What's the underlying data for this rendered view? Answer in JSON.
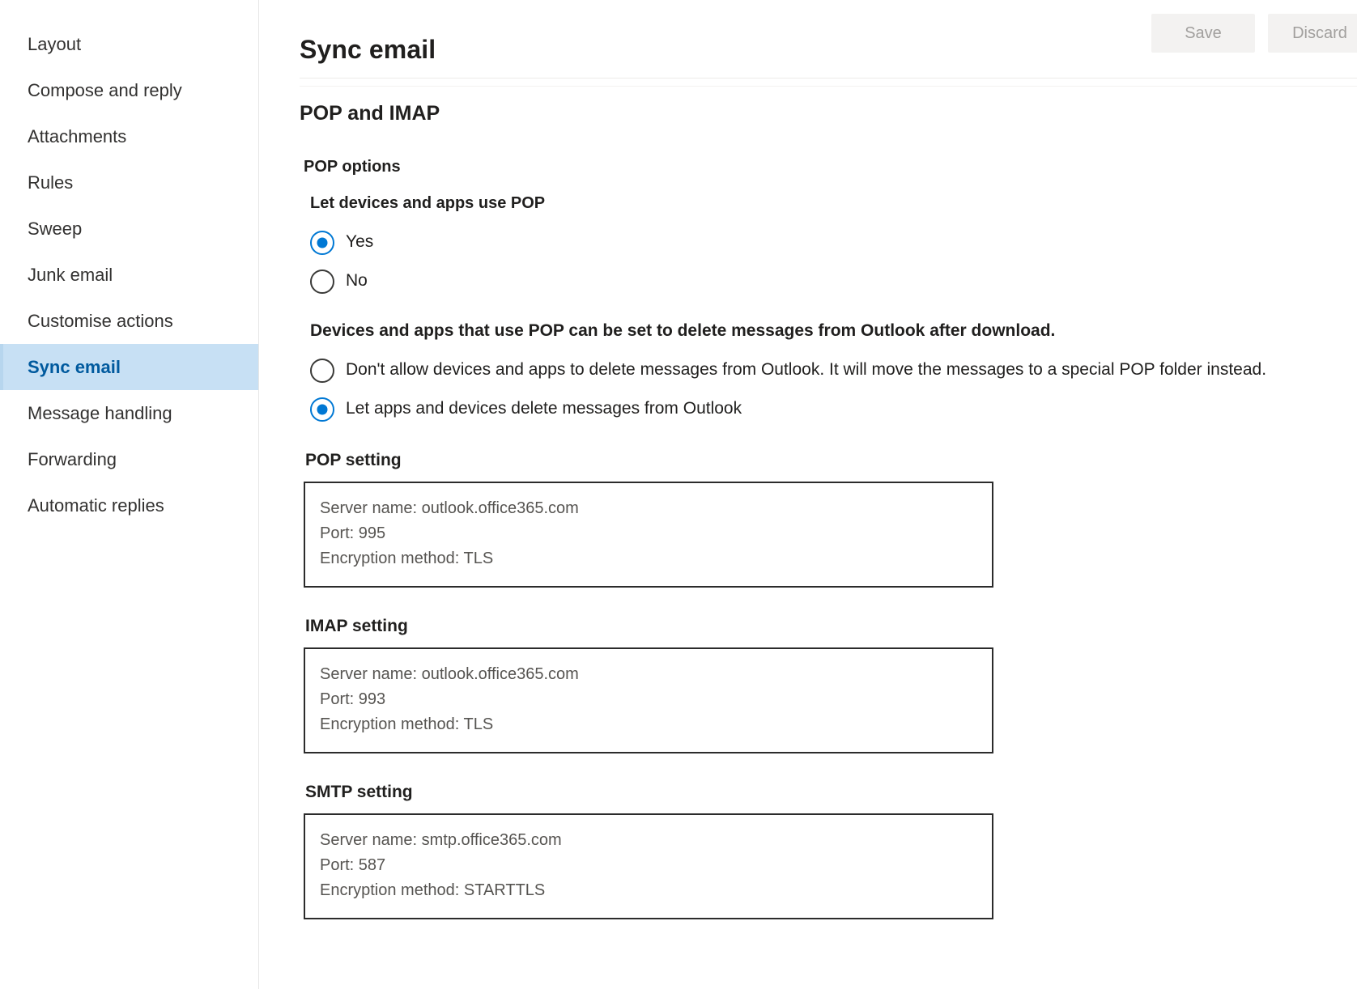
{
  "sidebar": {
    "items": [
      {
        "label": "Layout",
        "selected": false
      },
      {
        "label": "Compose and reply",
        "selected": false
      },
      {
        "label": "Attachments",
        "selected": false
      },
      {
        "label": "Rules",
        "selected": false
      },
      {
        "label": "Sweep",
        "selected": false
      },
      {
        "label": "Junk email",
        "selected": false
      },
      {
        "label": "Customise actions",
        "selected": false
      },
      {
        "label": "Sync email",
        "selected": true
      },
      {
        "label": "Message handling",
        "selected": false
      },
      {
        "label": "Forwarding",
        "selected": false
      },
      {
        "label": "Automatic replies",
        "selected": false
      }
    ]
  },
  "header": {
    "title": "Sync email",
    "save_label": "Save",
    "discard_label": "Discard"
  },
  "main": {
    "section_title": "POP and IMAP",
    "pop_options_title": "POP options",
    "pop_use_label": "Let devices and apps use POP",
    "pop_use_options": [
      {
        "label": "Yes",
        "checked": true
      },
      {
        "label": "No",
        "checked": false
      }
    ],
    "delete_statement": "Devices and apps that use POP can be set to delete messages from Outlook after download.",
    "delete_options": [
      {
        "label": "Don't allow devices and apps to delete messages from Outlook. It will move the messages to a special POP folder instead.",
        "checked": false
      },
      {
        "label": "Let apps and devices delete messages from Outlook",
        "checked": true
      }
    ],
    "settings": [
      {
        "label": "POP setting",
        "server": "Server name: outlook.office365.com",
        "port": "Port: 995",
        "encryption": "Encryption method: TLS"
      },
      {
        "label": "IMAP setting",
        "server": "Server name: outlook.office365.com",
        "port": "Port: 993",
        "encryption": "Encryption method: TLS"
      },
      {
        "label": "SMTP setting",
        "server": "Server name: smtp.office365.com",
        "port": "Port: 587",
        "encryption": "Encryption method: STARTTLS"
      }
    ]
  },
  "colors": {
    "accent": "#0078d4",
    "selected_bg": "#c7e0f4",
    "selected_text": "#005a9e"
  }
}
